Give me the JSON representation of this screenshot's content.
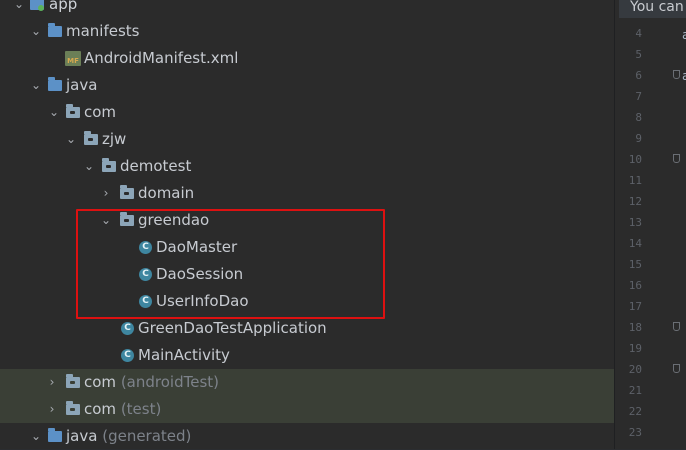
{
  "tree": {
    "app": "app",
    "manifests": "manifests",
    "manifest_file": "AndroidManifest.xml",
    "xml_badge": "MF",
    "java": "java",
    "com": "com",
    "zjw": "zjw",
    "demotest": "demotest",
    "domain": "domain",
    "greendao": "greendao",
    "dao_master": "DaoMaster",
    "dao_session": "DaoSession",
    "user_info_dao": "UserInfoDao",
    "app_class": "GreenDaoTestApplication",
    "main_activity": "MainActivity",
    "com_android_test": "com",
    "android_test_suffix": "(androidTest)",
    "com_test": "com",
    "test_suffix": "(test)",
    "java_generated": "java",
    "generated_suffix": "(generated)",
    "class_badge": "C"
  },
  "editor": {
    "notice": "You can",
    "line_numbers": [
      "4",
      "5",
      "6",
      "7",
      "8",
      "9",
      "10",
      "11",
      "12",
      "13",
      "14",
      "15",
      "16",
      "17",
      "18",
      "19",
      "20",
      "21",
      "22",
      "23"
    ],
    "code_line4": "a",
    "code_line6": "a"
  },
  "colors": {
    "highlight_border": "#dd1111",
    "class_icon": "#3e86a0",
    "folder_icon": "#8ca5b8",
    "source_folder_icon": "#5c91c7"
  }
}
